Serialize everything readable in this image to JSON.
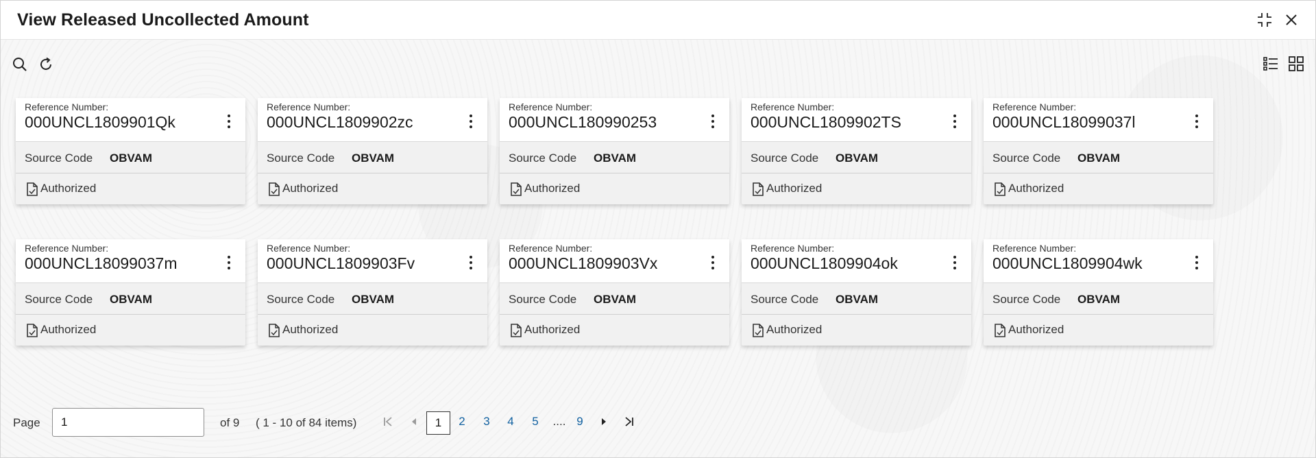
{
  "window": {
    "title": "View Released Uncollected Amount"
  },
  "cards": [
    {
      "ref_label": "Reference Number:",
      "ref": "000UNCL1809901Qk",
      "source_label": "Source Code",
      "source": "OBVAM",
      "status": "Authorized"
    },
    {
      "ref_label": "Reference Number:",
      "ref": "000UNCL1809902zc",
      "source_label": "Source Code",
      "source": "OBVAM",
      "status": "Authorized"
    },
    {
      "ref_label": "Reference Number:",
      "ref": "000UNCL180990253",
      "source_label": "Source Code",
      "source": "OBVAM",
      "status": "Authorized"
    },
    {
      "ref_label": "Reference Number:",
      "ref": "000UNCL1809902TS",
      "source_label": "Source Code",
      "source": "OBVAM",
      "status": "Authorized"
    },
    {
      "ref_label": "Reference Number:",
      "ref": "000UNCL18099037l",
      "source_label": "Source Code",
      "source": "OBVAM",
      "status": "Authorized"
    },
    {
      "ref_label": "Reference Number:",
      "ref": "000UNCL18099037m",
      "source_label": "Source Code",
      "source": "OBVAM",
      "status": "Authorized"
    },
    {
      "ref_label": "Reference Number:",
      "ref": "000UNCL1809903Fv",
      "source_label": "Source Code",
      "source": "OBVAM",
      "status": "Authorized"
    },
    {
      "ref_label": "Reference Number:",
      "ref": "000UNCL1809903Vx",
      "source_label": "Source Code",
      "source": "OBVAM",
      "status": "Authorized"
    },
    {
      "ref_label": "Reference Number:",
      "ref": "000UNCL1809904ok",
      "source_label": "Source Code",
      "source": "OBVAM",
      "status": "Authorized"
    },
    {
      "ref_label": "Reference Number:",
      "ref": "000UNCL1809904wk",
      "source_label": "Source Code",
      "source": "OBVAM",
      "status": "Authorized"
    }
  ],
  "pager": {
    "page_label": "Page",
    "page_value": "1",
    "of_text": "of 9",
    "items_text": "( 1 - 10 of 84 items)",
    "pages": [
      "1",
      "2",
      "3",
      "4",
      "5",
      "....",
      "9"
    ]
  },
  "icons": {
    "search": "search-icon",
    "refresh": "refresh-icon",
    "list_view": "list-view-icon",
    "grid_view": "grid-view-icon",
    "minimize": "minimize-icon",
    "close": "close-icon"
  },
  "colors": {
    "link": "#1060a0",
    "card_header": "#ffffff",
    "card_body": "#f1f1f1"
  }
}
